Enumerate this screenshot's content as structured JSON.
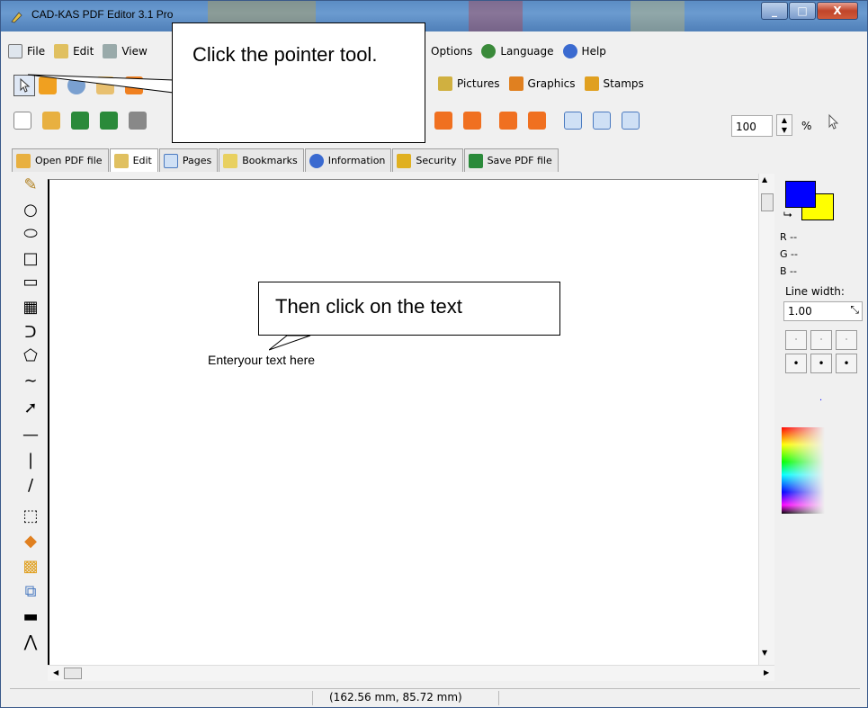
{
  "window": {
    "title": "CAD-KAS PDF Editor 3.1 Pro",
    "minimize": "_",
    "maximize": "□",
    "close": "X"
  },
  "menu": {
    "file": "File",
    "edit": "Edit",
    "view": "View",
    "options": "Options",
    "language": "Language",
    "help": "Help"
  },
  "toolbar2": {
    "pictures": "Pictures",
    "graphics": "Graphics",
    "stamps": "Stamps"
  },
  "zoom": {
    "value": "100",
    "unit": "%"
  },
  "tabs": [
    "Open PDF file",
    "Edit",
    "Pages",
    "Bookmarks",
    "Information",
    "Security",
    "Save PDF file"
  ],
  "canvas": {
    "text": "Enteryour text here"
  },
  "callouts": {
    "first": "Click the pointer tool.",
    "second": "Then click on the text"
  },
  "right_panel": {
    "r": "R --",
    "g": "G --",
    "b": "B --",
    "line_width_label": "Line width:",
    "line_width_value": "1.00"
  },
  "status": {
    "coords": "(162.56 mm, 85.72 mm)"
  },
  "colors": {
    "fg": "#0000ff",
    "bg": "#ffff00"
  }
}
